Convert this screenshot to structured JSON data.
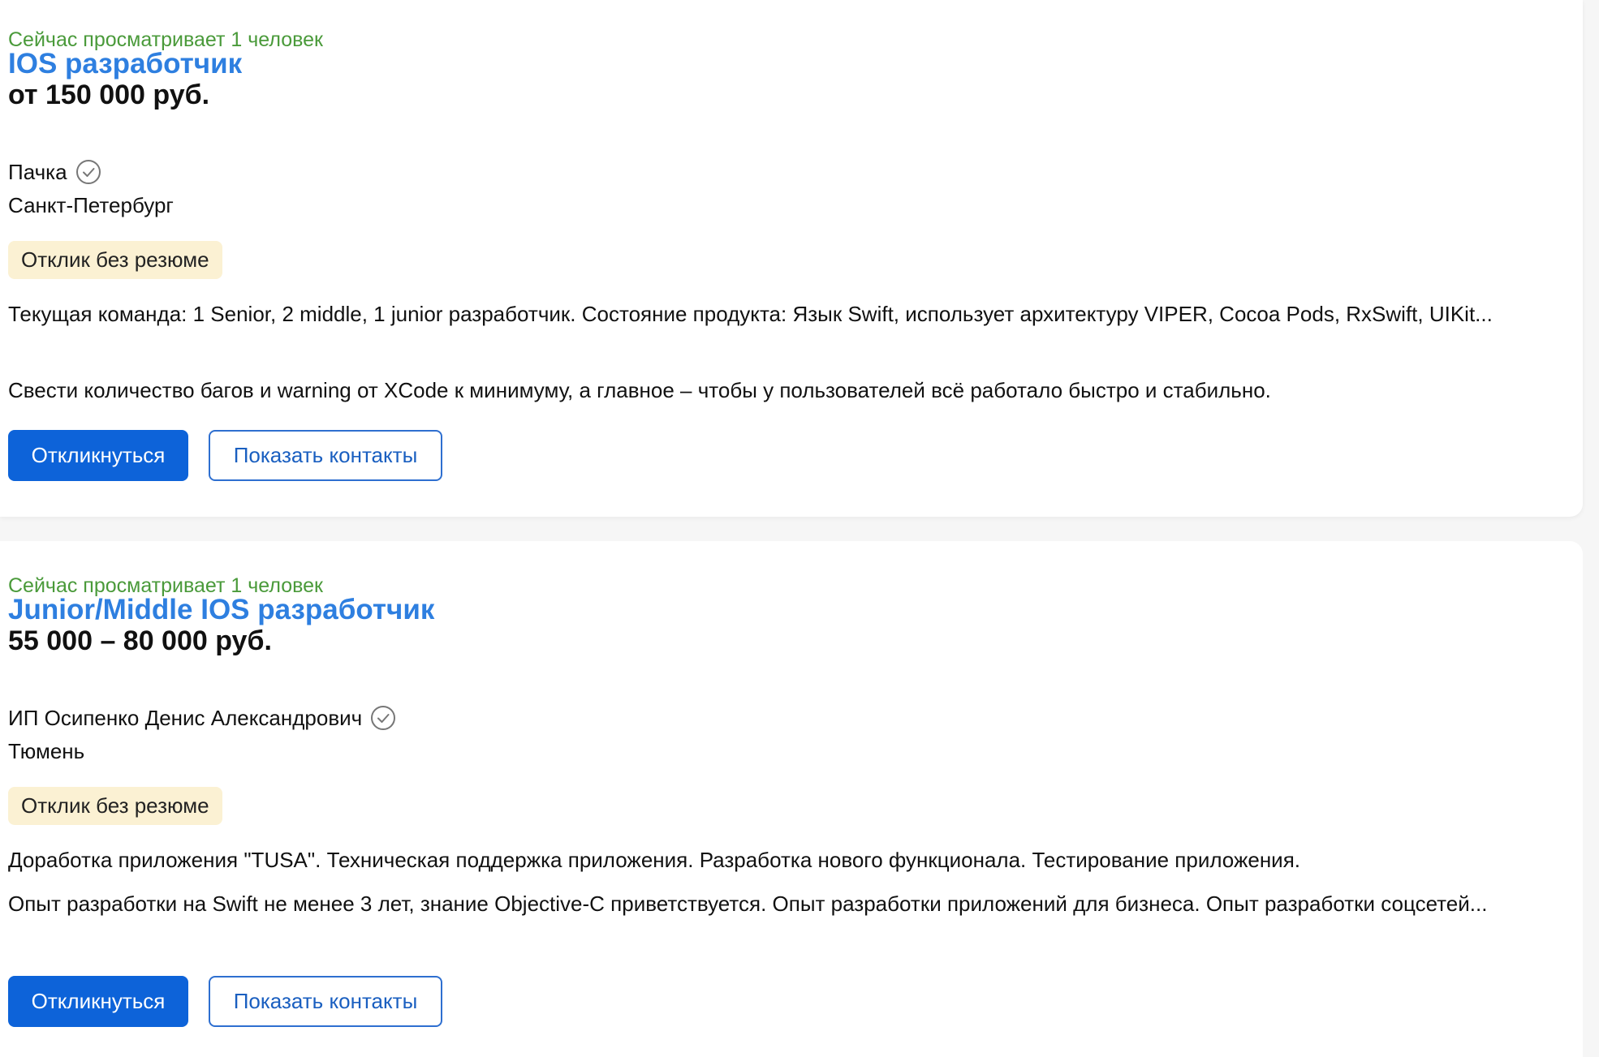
{
  "vacancies": [
    {
      "viewers": "Сейчас просматривает 1 человек",
      "title": "IOS разработчик",
      "salary": "от 150 000 руб.",
      "employer": "Пачка",
      "city": "Санкт-Петербург",
      "badge": "Отклик без резюме",
      "description_1": "Текущая команда: 1 Senior, 2 middle, 1 junior разработчик. Состояние продукта: Язык Swift, использует архитектуру VIPER, Cocoa Pods, RxSwift, UIKit...",
      "description_2": "Свести количество багов и warning от XCode к минимуму, а главное – чтобы у пользователей всё работало быстро и стабильно.",
      "respond_label": "Откликнуться",
      "contacts_label": "Показать контакты"
    },
    {
      "viewers": "Сейчас просматривает 1 человек",
      "title": "Junior/Middle IOS разработчик",
      "salary": "55 000 – 80 000 руб.",
      "employer": "ИП Осипенко Денис Александрович",
      "city": "Тюмень",
      "badge": "Отклик без резюме",
      "description_1": "Доработка приложения \"TUSA\". Техническая поддержка приложения. Разработка нового функционала. Тестирование приложения.",
      "description_2": "Опыт разработки на Swift не менее 3 лет, знание Objective-C приветствуется. Опыт разработки приложений для бизнеса. Опыт разработки соцсетей...",
      "respond_label": "Откликнуться",
      "contacts_label": "Показать контакты"
    }
  ],
  "colors": {
    "viewers_green": "#4a9a3a",
    "title_blue": "#2e7fe0",
    "primary_button": "#0d63d9",
    "badge_bg": "#fbf1d3"
  },
  "icons": {
    "verified": "check-circle-icon"
  }
}
